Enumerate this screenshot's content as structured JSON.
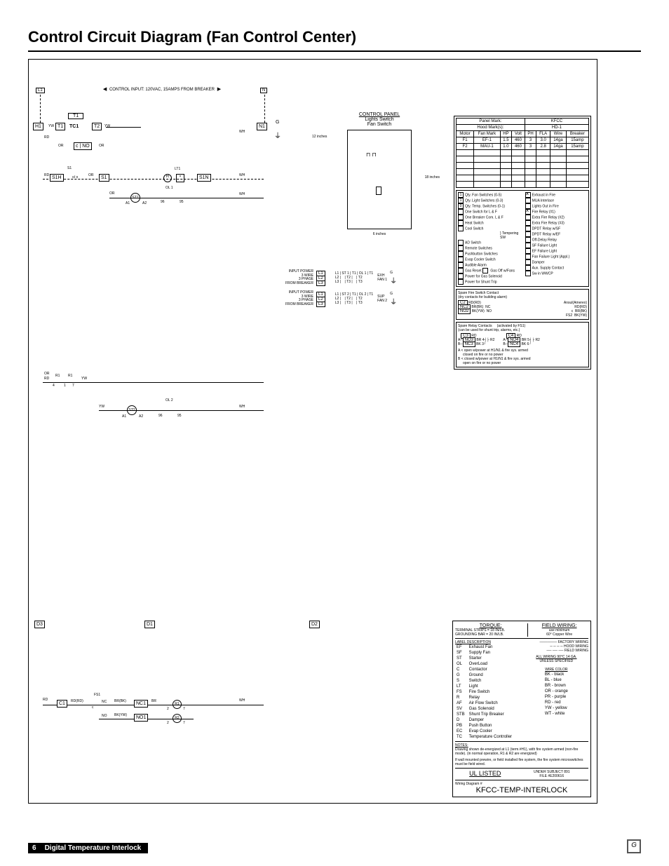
{
  "page": {
    "title": "Control Circuit Diagram (Fan Control Center)",
    "number": "6",
    "footer_label": "Digital Temperature Interlock"
  },
  "schematic": {
    "l1": "L1",
    "n": "N",
    "control_input": "CONTROL INPUT: 120VAC, 15AMPS FROM BREAKER",
    "h1": "H1",
    "n1": "N1",
    "t1": "T1",
    "t2": "T2",
    "tc1": "TC1",
    "yw": "YW",
    "rd": "RD",
    "or": "OR",
    "wh": "WH",
    "bk": "BK",
    "br": "BR",
    "no": "NO",
    "s1": "S1",
    "s1h": "S1H",
    "s1n": "S1N",
    "lt1": "LT1",
    "r": "R",
    "st1": "ST 1",
    "ol1_lbl": "OL 1",
    "a1": "A1",
    "a2": "A2",
    "r1": "R1",
    "r1_4": "4",
    "r1_7": "7",
    "r1_1": "1",
    "ol2": "OL 2",
    "st2": "ST 2",
    "d3": "D3",
    "d1": "D1",
    "d2": "D2",
    "c1": "C1",
    "fs1": "FS1",
    "nc": "NC",
    "nc1": "NC1",
    "no1": "NO1",
    "r_1": "R1",
    "r_2": "R2",
    "rd_rd": "RD(RD)",
    "br_bk": "BR(BK)",
    "bk_yw": "BK(YW)",
    "ol1_95": "95",
    "ol1_96": "96",
    "g": "G",
    "input_power": "INPUT POWER\n3 WIRE\n3 PHASE\nFROM BREAKER",
    "l_l1": "L1",
    "l_l2": "L2",
    "l_l3": "L3",
    "t_t1": "T1",
    "t_t2": "T2",
    "t_t3": "T3",
    "exh": "EXH",
    "sup": "SUP",
    "fan1": "FAN   1",
    "fan2": "FAN   2",
    "control_panel": "CONTROL PANEL",
    "lights_switch": "Lights Switch",
    "fan_switch": "Fan Switch",
    "dim12": "12 inches",
    "dim18": "18 inches",
    "dim6": "6 inches",
    "spare_fire": "Spare Fire Switch Contact",
    "dry_contacts": "(dry contacts for building alarm)",
    "ansul": "Ansul(Amerex)",
    "c2": "C2",
    "nc2": "NC2",
    "no2": "NO2",
    "fs2": "FS2",
    "spare_relay": "Spare Relay Contacts",
    "activated": "(activated by FS1)",
    "shunt_use": "(can be used for shunt trip, alarms, etc.)",
    "c3": "C3",
    "no3": "NO3",
    "nc3": "NC3",
    "c4": "C4",
    "no4": "NO4",
    "nc4": "NC4",
    "a_open": "open w/power at H1/N1 & fire sys. armed",
    "a_closed": "closed on fire or no power",
    "b_closed": "closed w/power at H1/N1 & fire sys. armed",
    "b_open": "open on fire or no power",
    "r2n_3": "3",
    "r2n_4": "4",
    "r2n_5": "5",
    "r2n_6": "6",
    "r2_lbl": "R2",
    "a": "A",
    "b": "B",
    "c": "c"
  },
  "panel_info": {
    "panel_mark_lbl": "Panel Mark:",
    "panel_mark": "KFCC",
    "hood_marks_lbl": "Hood Mark(s):",
    "hood_marks": "HD-1",
    "headers": [
      "Motor",
      "Fan Mark",
      "HP",
      "Volt",
      "PH",
      "FLA",
      "Wire",
      "Breaker"
    ],
    "rows": [
      [
        "F1",
        "EF-1",
        "1.5",
        "460",
        "3",
        "3.0",
        "14ga",
        "15amp"
      ],
      [
        "F2",
        "MAU-1",
        "1.0",
        "460",
        "3",
        "2.8",
        "14ga",
        "15amp"
      ]
    ]
  },
  "option_checks": {
    "left": [
      {
        "n": "1",
        "lbl": "Qty. Fan Switches (0-5)"
      },
      {
        "n": "1",
        "lbl": "Qty. Light Switches (0-3)"
      },
      {
        "n": "0",
        "lbl": "Qty. Temp. Switches (0-1)"
      },
      {
        "c": false,
        "lbl": "One Switch for L & F"
      },
      {
        "c": false,
        "lbl": "One Breaker Com. L & F"
      },
      {
        "c": false,
        "lbl": "Heat Switch"
      },
      {
        "c": false,
        "lbl": "Cool Switch"
      },
      {
        "c": false,
        "lbl": "AD Switch"
      },
      {
        "c": false,
        "lbl": "Remote Switches"
      },
      {
        "c": false,
        "lbl": "Pushbutton Switches"
      },
      {
        "c": false,
        "lbl": "Evap Cooler Switch"
      },
      {
        "c": false,
        "lbl": "Audible Alarm"
      },
      {
        "c": false,
        "lbl": "Gas Reset"
      },
      {
        "c": false,
        "lbl": "Power for Gas Solenoid"
      },
      {
        "c": false,
        "lbl": "Power for Shunt Trip"
      }
    ],
    "tempering": "Tempering SW",
    "gasoff": "Gas Off w/Fans",
    "right": [
      {
        "c": true,
        "lbl": "Exhaust in Fire"
      },
      {
        "c": false,
        "lbl": "MUA Interlace"
      },
      {
        "c": false,
        "lbl": "Lights Out in Fire"
      },
      {
        "c": true,
        "lbl": "Fire Relay (#1)"
      },
      {
        "c": false,
        "lbl": "Extra Fire Relay (#2)"
      },
      {
        "c": false,
        "lbl": "Extra Fire Relay (#3)"
      },
      {
        "c": false,
        "lbl": "DPDT Relay w/SF"
      },
      {
        "c": false,
        "lbl": "DPDT Relay w/EF"
      },
      {
        "c": false,
        "lbl": "Off-Delay Relay"
      },
      {
        "c": false,
        "lbl": "SF Failure Light"
      },
      {
        "c": false,
        "lbl": "EF Failure Light"
      },
      {
        "c": false,
        "lbl": "Fan Failure Light (Appl.)"
      },
      {
        "c": false,
        "lbl": "Damper"
      },
      {
        "c": false,
        "lbl": "Aux. Supply Contact"
      },
      {
        "c": false,
        "lbl": "Sw in WWCP"
      }
    ]
  },
  "torque": {
    "title": "TORQUE:",
    "l1": "TERMINAL STRIPS = 18 IN/LB.",
    "l2": "GROUNDING BAR = 20 IN/LB."
  },
  "field_wiring": {
    "title": "FIELD WIRING:",
    "l1": "use minimum",
    "l2": "60° Copper Wire"
  },
  "labels": {
    "title": "LABEL DESCRIPTION",
    "rows": [
      [
        "EF",
        "Exhaust Fan"
      ],
      [
        "SF",
        "Supply Fan"
      ],
      [
        "ST",
        "Starter"
      ],
      [
        "OL",
        "OverLoad"
      ],
      [
        "C",
        "Contactor"
      ],
      [
        "G",
        "Ground"
      ],
      [
        "S",
        "Switch"
      ],
      [
        "LT",
        "Light"
      ],
      [
        "FS",
        "Fire Switch"
      ],
      [
        "R",
        "Relay"
      ],
      [
        "AF",
        "Air Flow Switch"
      ],
      [
        "SV",
        "Gas Solenoid"
      ],
      [
        "STB",
        "Shunt Trip Breaker"
      ],
      [
        "D",
        "Damper"
      ],
      [
        "PB",
        "Push Button"
      ],
      [
        "EC",
        "Evap Cooler"
      ],
      [
        "TC",
        "Temperature Controller"
      ]
    ]
  },
  "line_types": {
    "factory": "FACTORY WIRING",
    "hood": "HOOD WIRING",
    "field": "FIELD WIRING"
  },
  "all_wiring": {
    "l1": "ALL WIRING 90°C 14 GA.",
    "l2": "UNLESS SPECIFIED"
  },
  "wire_color": {
    "title": "WIRE COLOR",
    "rows": [
      [
        "BK",
        "black"
      ],
      [
        "BL",
        "blue"
      ],
      [
        "BR",
        "brown"
      ],
      [
        "OR",
        "orange"
      ],
      [
        "PR",
        "purple"
      ],
      [
        "RD",
        "red"
      ],
      [
        "YW",
        "yellow"
      ],
      [
        "WT",
        "white"
      ]
    ]
  },
  "notes": {
    "title": "NOTES:",
    "l1": "Drawing shown de-energized at L1 (term.#H1), with fire system armed (non-fire mode). (in normal operation, R1 & R2 are energized)",
    "l2": "If wall mounted prewire, or field installed fire system, the fire system microswitches must be field wired."
  },
  "ul": {
    "listed": "UL LISTED",
    "subject": "UNDER SUBJECT 891",
    "file": "FILE #E200616"
  },
  "wdn": "Wiring Diagram #",
  "model": "KFCC-TEMP-INTERLOCK"
}
